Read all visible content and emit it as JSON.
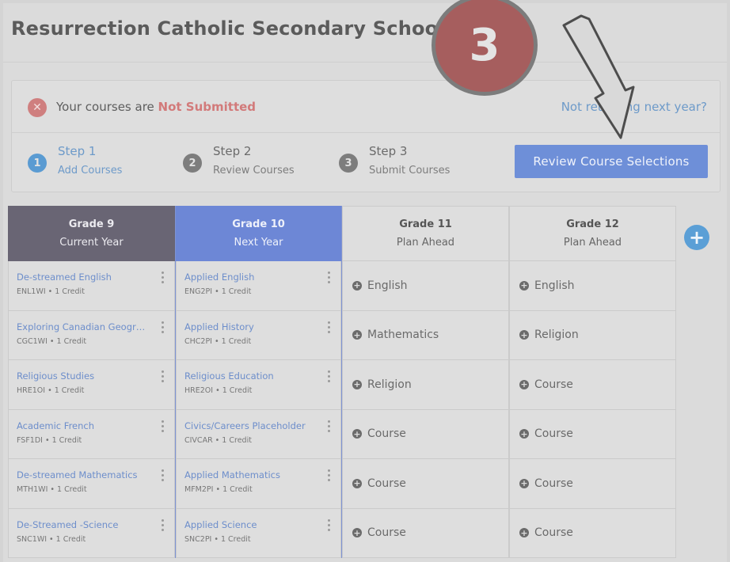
{
  "header": {
    "title": "Resurrection Catholic Secondary School"
  },
  "status": {
    "prefix": "Your courses are ",
    "state": "Not Submitted",
    "link": "Not returning next year?"
  },
  "steps": [
    {
      "number": "1",
      "title": "Step 1",
      "subtitle": "Add Courses"
    },
    {
      "number": "2",
      "title": "Step 2",
      "subtitle": "Review Courses"
    },
    {
      "number": "3",
      "title": "Step 3",
      "subtitle": "Submit Courses"
    }
  ],
  "review_button": "Review Course Selections",
  "annotation": {
    "badge": "3"
  },
  "columns": [
    {
      "grade": "Grade 9",
      "subtitle": "Current Year",
      "courses": [
        {
          "name": "De-streamed English",
          "code": "ENL1WI • 1 Credit"
        },
        {
          "name": "Exploring Canadian Geogr…",
          "code": "CGC1WI • 1 Credit"
        },
        {
          "name": "Religious Studies",
          "code": "HRE1OI • 1 Credit"
        },
        {
          "name": "Academic French",
          "code": "FSF1DI • 1 Credit"
        },
        {
          "name": "De-streamed Mathematics",
          "code": "MTH1WI • 1 Credit"
        },
        {
          "name": "De-Streamed -Science",
          "code": "SNC1WI • 1 Credit"
        }
      ]
    },
    {
      "grade": "Grade 10",
      "subtitle": "Next Year",
      "courses": [
        {
          "name": "Applied English",
          "code": "ENG2PI • 1 Credit"
        },
        {
          "name": "Applied History",
          "code": "CHC2PI • 1 Credit"
        },
        {
          "name": "Religious Education",
          "code": "HRE2OI • 1 Credit"
        },
        {
          "name": "Civics/Careers Placeholder",
          "code": "CIVCAR • 1 Credit"
        },
        {
          "name": "Applied Mathematics",
          "code": "MFM2PI • 1 Credit"
        },
        {
          "name": "Applied Science",
          "code": "SNC2PI • 1 Credit"
        }
      ]
    },
    {
      "grade": "Grade 11",
      "subtitle": "Plan Ahead",
      "plans": [
        "English",
        "Mathematics",
        "Religion",
        "Course",
        "Course",
        "Course"
      ]
    },
    {
      "grade": "Grade 12",
      "subtitle": "Plan Ahead",
      "plans": [
        "English",
        "Religion",
        "Course",
        "Course",
        "Course",
        "Course"
      ]
    }
  ],
  "icons": {
    "status": "close-icon",
    "add_column": "plus-icon",
    "plan_add": "plus-circle-icon",
    "course_menu": "kebab-menu-icon",
    "annotation_arrow": "arrow-pointer-icon"
  },
  "colors": {
    "grade9_header": "#696574",
    "grade10_header": "#6d87d6",
    "review_button": "#6e8fd8",
    "not_submitted": "#d27a7a",
    "link": "#6d9ac9",
    "badge": "#a65e5e"
  }
}
